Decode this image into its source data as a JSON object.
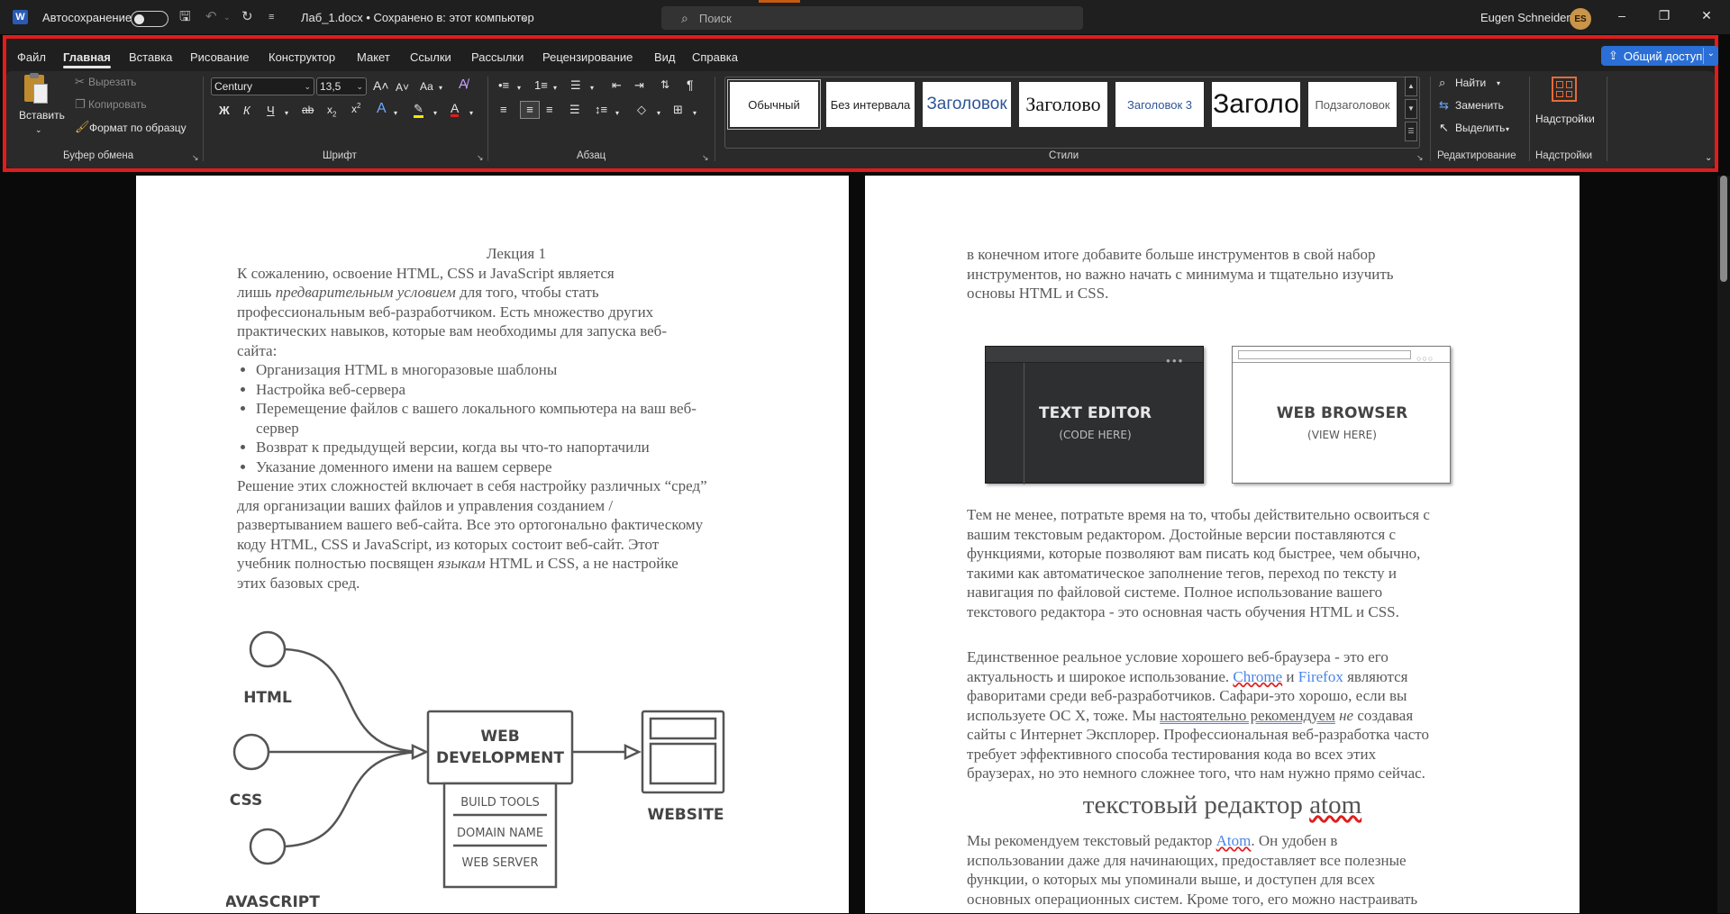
{
  "titlebar": {
    "app_icon_letter": "W",
    "autosave_label": "Автосохранение",
    "doc_title": "Лаб_1.docx • Сохранено в: этот компьютер",
    "search_placeholder": "Поиск",
    "user_name": "Eugen Schneider",
    "user_initials": "ES"
  },
  "tabs": [
    "Файл",
    "Главная",
    "Вставка",
    "Рисование",
    "Конструктор",
    "Макет",
    "Ссылки",
    "Рассылки",
    "Рецензирование",
    "Вид",
    "Справка"
  ],
  "active_tab": "Главная",
  "share_label": "Общий доступ",
  "clipboard": {
    "paste_label": "Вставить",
    "cut_label": "Вырезать",
    "copy_label": "Копировать",
    "format_painter_label": "Формат по образцу",
    "group_label": "Буфер обмена"
  },
  "font": {
    "font_name": "Century",
    "font_size": "13,5",
    "case_label": "Аа",
    "bold_glyph": "Ж",
    "italic_glyph": "К",
    "underline_glyph": "Ч",
    "strike_glyph": "ab",
    "group_label": "Шрифт"
  },
  "paragraph": {
    "group_label": "Абзац"
  },
  "styles": {
    "items": [
      "Обычный",
      "Без интервала",
      "Заголовок",
      "Заголово",
      "Заголовок 3",
      "Заголо",
      "Подзаголовок"
    ],
    "group_label": "Стили"
  },
  "editing": {
    "find_label": "Найти",
    "replace_label": "Заменить",
    "select_label": "Выделить",
    "group_label": "Редактирование"
  },
  "addins": {
    "button_label": "Надстройки",
    "group_label": "Надстройки"
  },
  "colors": {
    "accent": "#2b6fd6",
    "highlight_frame": "#e11c1c",
    "link": "#4a86e8"
  },
  "page_left": {
    "heading": "Лекция 1",
    "intro_1": "К сожалению, освоение HTML, CSS и JavaScript является",
    "intro_2a": "лишь ",
    "intro_2_italic": "предварительным условием",
    "intro_2b": " для того, чтобы стать",
    "intro_3": "профессиональным веб-разработчиком. Есть множество других",
    "intro_4": "практических навыков, которые вам необходимы для запуска веб-",
    "intro_5": "сайта:",
    "bullets": [
      "Организация HTML в многоразовые шаблоны",
      "Настройка веб-сервера",
      "Перемещение файлов с вашего локального компьютера на ваш веб-",
      "сервер",
      "Возврат к предыдущей версии, когда вы что-то напортачили",
      "Указание доменного имени на вашем сервере"
    ],
    "body_1": "Решение этих сложностей включает в себя настройку различных “сред”",
    "body_2": "для организации ваших файлов и управления созданием /",
    "body_3": "развертыванием вашего веб-сайта. Все это ортогонально фактическому",
    "body_4": "коду HTML, CSS и JavaScript, из которых состоит веб-сайт. Этот",
    "body_5a": "учебник полностью посвящен ",
    "body_5_italic": "языкам",
    "body_5b": " HTML и CSS, а не настройке",
    "body_6": "этих базовых сред.",
    "diagram": {
      "html": "HTML",
      "css": "CSS",
      "javascript": "JAVASCRIPT",
      "web_dev_1": "WEB",
      "web_dev_2": "DEVELOPMENT",
      "build_tools": "BUILD TOOLS",
      "domain_name": "DOMAIN NAME",
      "web_server": "WEB SERVER",
      "website": "WEBSITE"
    }
  },
  "page_right": {
    "p1_1": "в конечном итоге добавите больше инструментов в свой набор",
    "p1_2": "инструментов, но важно начать с минимума и тщательно изучить",
    "p1_3": "основы HTML и CSS.",
    "editor_title": "TEXT EDITOR",
    "editor_sub": "(CODE HERE)",
    "browser_title": "WEB BROWSER",
    "browser_sub": "(VIEW HERE)",
    "p2": [
      "Тем не менее, потратьте время на то, чтобы действительно освоиться с",
      "вашим текстовым редактором. Достойные версии поставляются с",
      "функциями, которые позволяют вам писать код быстрее, чем обычно,",
      "такими как автоматическое заполнение тегов, переход по тексту и",
      "навигация по файловой системе. Полное использование вашего",
      "текстового редактора - это основная часть обучения HTML и CSS."
    ],
    "p3_1": "Единственное реальное условие хорошего веб-браузера - это его",
    "p3_2a": "актуальность и широкое использование. ",
    "p3_chrome": "Chrome",
    "p3_2b": " и ",
    "p3_firefox": "Firefox",
    "p3_2c": " являются",
    "p3_3": "фаворитами среди веб-разработчиков. Сафари-это хорошо, если вы",
    "p3_4a": "используете ОС X, тоже. Мы ",
    "p3_4_ul": "настоятельно рекомендуем",
    "p3_4_it": " не",
    "p3_4b": " создавая",
    "p3_5": "сайты с Интернет Эксплорер. Профессиональная веб-разработка часто",
    "p3_6": "требует эффективного способа тестирования кода во всех этих",
    "p3_7": "браузерах, но это немного сложнее того, что нам нужно прямо сейчас.",
    "h2a": "текстовый редактор ",
    "h2b": "atom",
    "p4_1a": "Мы рекомендуем текстовый редактор ",
    "p4_atom": "Atom",
    "p4_1b": ". Он удобен в",
    "p4_2": "использовании даже для начинающих, предоставляет все полезные",
    "p4_3": "функции, о которых мы упоминали выше, и доступен для всех",
    "p4_4": "основных операционных систем. Кроме того, его можно настраивать"
  }
}
